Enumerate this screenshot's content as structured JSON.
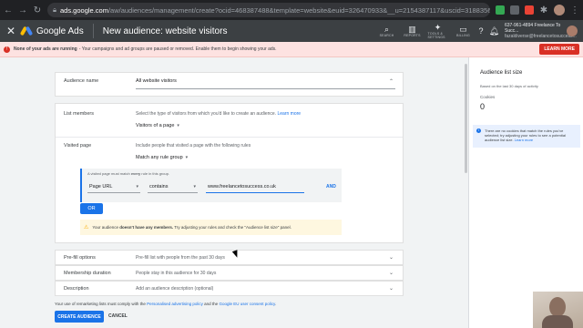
{
  "browser": {
    "url_host": "ads.google.com",
    "url_path": "/aw/audiences/management/create?ocid=468387488&template=website&euid=326470933&__u=2154387117&uscid=318835637&..."
  },
  "appbar": {
    "product": "Google Ads",
    "title": "New audience: website visitors",
    "tools": [
      {
        "icon": "search-icon",
        "glyph": "⌕",
        "label": "SEARCH"
      },
      {
        "icon": "reports-icon",
        "glyph": "▥",
        "label": "REPORTS"
      },
      {
        "icon": "tools-icon",
        "glyph": "✦",
        "label": "TOOLS & SETTINGS"
      },
      {
        "icon": "billing-icon",
        "glyph": "▭",
        "label": "BILLING"
      }
    ],
    "account_line1": "637-961-4894 Freelance To Succ...",
    "account_line2": "fazaldiverse@freelancetosuccess..."
  },
  "notice": {
    "bold": "None of your ads are running",
    "text": " - Your campaigns and ad groups are paused or removed. Enable them to begin showing your ads.",
    "button": "LEARN MORE"
  },
  "audience_name": {
    "label": "Audience name",
    "value": "All website visitors"
  },
  "list_members": {
    "label": "List members",
    "help": "Select the type of visitors from which you'd like to create an audience.",
    "help_link": "Learn more",
    "value": "Visitors of a page"
  },
  "visited_page": {
    "label": "Visited page",
    "help": "Include people that visited a page with the following rules",
    "group": "Match any rule group",
    "rule_hint_pre": "A visited page must match ",
    "rule_hint_bold": "every",
    "rule_hint_post": " rule in this group.",
    "field": "Page URL",
    "operator": "contains",
    "value": "www.freelancetosuccess.co.uk",
    "and_label": "AND",
    "or_label": "OR",
    "warning_pre": "Your audience ",
    "warning_bold": "doesn't have any members.",
    "warning_post": " Try adjusting your rules and check the \"Audience list size\" panel."
  },
  "prefill": {
    "label": "Pre-fill options",
    "value": "Pre-fill list with people from the past 30 days"
  },
  "duration": {
    "label": "Membership duration",
    "value": "People stay in this audience for 30 days"
  },
  "description": {
    "label": "Description",
    "value": "Add an audience description (optional)"
  },
  "footer": {
    "note_pre": "Your use of remarketing lists must comply with the ",
    "link1": "Personalised advertising policy",
    "note_mid": " and the ",
    "link2": "Google EU user consent policy",
    "note_post": ".",
    "create": "CREATE AUDIENCE",
    "cancel": "CANCEL"
  },
  "side": {
    "title": "Audience list size",
    "sub": "Based on the last 30 days of activity",
    "cookies_label": "Cookies",
    "cookies_value": "0",
    "info": "There are no cookies that match the rules you've selected; try adjusting your rules to see a potential audience list size.",
    "info_link": "Learn more"
  },
  "colors": {
    "accent": "#1a73e8",
    "error": "#d93025",
    "warning_bg": "#fef7e0",
    "appbar": "#3c4043"
  }
}
